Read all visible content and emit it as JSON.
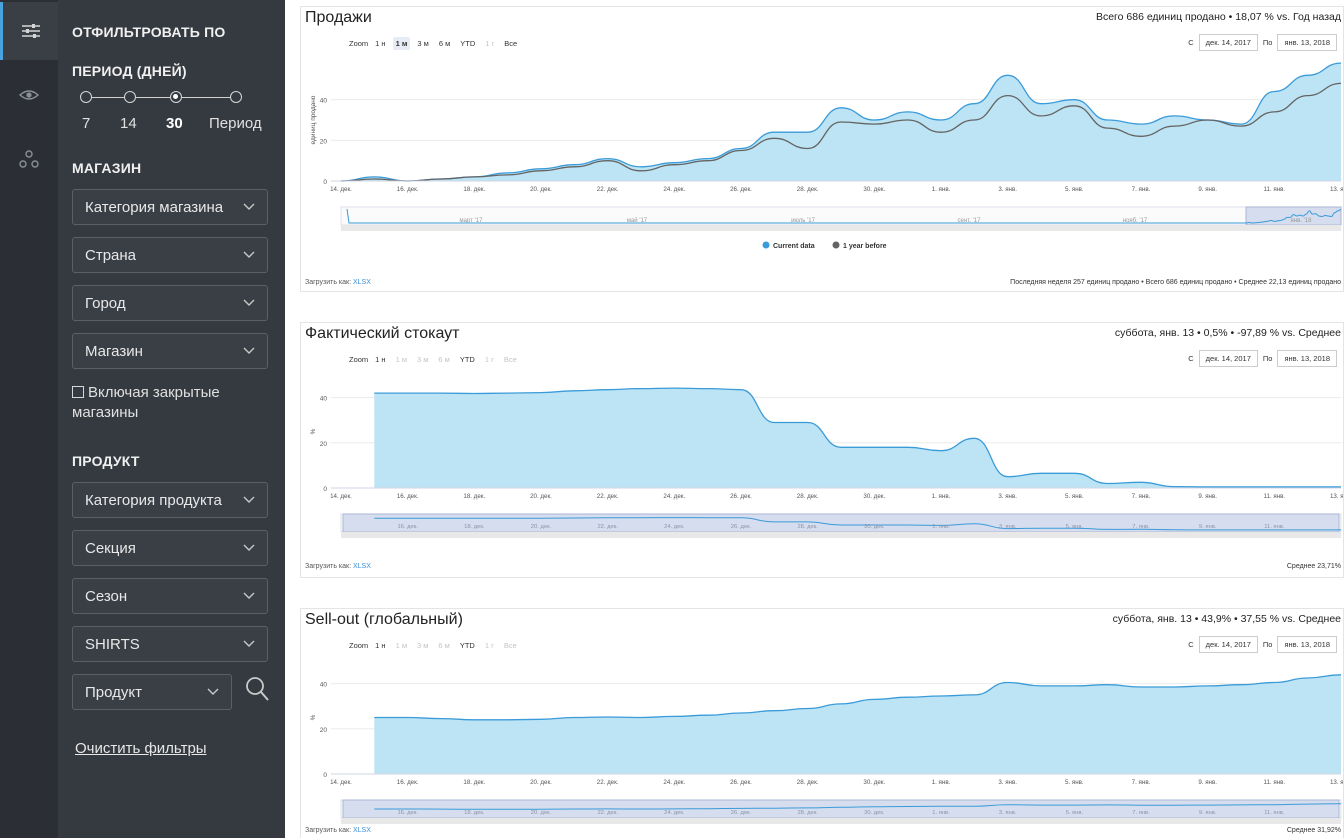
{
  "rail": {
    "icons": [
      "sliders-icon",
      "eye-icon",
      "nodes-icon"
    ]
  },
  "sidebar": {
    "filter_heading": "ОТФИЛЬТРОВАТЬ ПО",
    "period_heading": "ПЕРИОД (ДНЕЙ)",
    "period_options": [
      "7",
      "14",
      "30",
      "Период"
    ],
    "period_selected": "30",
    "store_heading": "МАГАЗИН",
    "store_category": "Категория магазина",
    "country": "Страна",
    "city": "Город",
    "store": "Магазин",
    "include_closed": "Включая закрытые магазины",
    "product_heading": "ПРОДУКТ",
    "product_category": "Категория продукта",
    "section": "Секция",
    "season": "Сезон",
    "shirts": "SHIRTS",
    "product": "Продукт",
    "clear_filters": "Очистить фильтры"
  },
  "zoom": {
    "label": "Zoom",
    "buttons": [
      "1 н",
      "1 м",
      "3 м",
      "6 м",
      "YTD",
      "1 г",
      "Все"
    ]
  },
  "range": {
    "from_label": "С",
    "from_value": "дек. 14, 2017",
    "to_label": "По",
    "to_value": "янв. 13, 2018"
  },
  "download": {
    "label": "Загрузить как:",
    "format": "XLSX"
  },
  "colors": {
    "current": "#3a9bd9",
    "fill": "#bde4f4",
    "prior": "#646464",
    "navigator": "#d6ddee"
  },
  "x_ticks": [
    "14. дек.",
    "16. дек.",
    "18. дек.",
    "20. дек.",
    "22. дек.",
    "24. дек.",
    "26. дек.",
    "28. дек.",
    "30. дек.",
    "1. янв.",
    "3. янв.",
    "5. янв.",
    "7. янв.",
    "9. янв.",
    "11. янв.",
    "13. янв."
  ],
  "sales": {
    "title": "Продажи",
    "summary": "Всего 686 единиц продано • 18,07 % vs. Год назад",
    "ylabel": "единиц продано",
    "yticks": [
      "0",
      "20",
      "40"
    ],
    "navigator_labels": [
      "март '17",
      "май '17",
      "июль '17",
      "сент. '17",
      "нояб. '17",
      "янв. '18"
    ],
    "legend_current": "Current data",
    "legend_prior": "1 year before",
    "footnote": "Последняя неделя 257 единиц продано • Всего 686 единиц продано • Среднее 22,13 единиц продано"
  },
  "stockout": {
    "title": "Фактический стокаут",
    "summary": "суббота, янв. 13 • 0,5% • -97,89 % vs. Среднее",
    "ylabel": "%",
    "yticks": [
      "0",
      "20",
      "40"
    ],
    "navigator_labels": [
      "16. дек.",
      "18. дек.",
      "20. дек.",
      "22. дек.",
      "24. дек.",
      "26. дек.",
      "28. дек.",
      "30. дек.",
      "1. янв.",
      "3. янв.",
      "5. янв.",
      "7. янв.",
      "9. янв.",
      "11. янв."
    ],
    "footnote": "Среднее 23,71%"
  },
  "sellout": {
    "title": "Sell-out (глобальный)",
    "summary": "суббота, янв. 13 • 43,9% • 37,55 % vs. Среднее",
    "ylabel": "%",
    "yticks": [
      "0",
      "20",
      "40"
    ],
    "navigator_labels": [
      "16. дек.",
      "18. дек.",
      "20. дек.",
      "22. дек.",
      "24. дек.",
      "26. дек.",
      "28. дек.",
      "30. дек.",
      "1. янв.",
      "3. янв.",
      "5. янв.",
      "7. янв.",
      "9. янв.",
      "11. янв."
    ],
    "footnote": "Среднее 31,92%"
  },
  "chart_data": [
    {
      "type": "area",
      "title": "Продажи",
      "xlabel": "",
      "ylabel": "единиц продано",
      "ylim": [
        0,
        60
      ],
      "x": [
        "14. дек.",
        "15. дек.",
        "16. дек.",
        "17. дек.",
        "18. дек.",
        "19. дек.",
        "20. дек.",
        "21. дек.",
        "22. дек.",
        "23. дек.",
        "24. дек.",
        "25. дек.",
        "26. дек.",
        "27. дек.",
        "28. дек.",
        "29. дек.",
        "30. дек.",
        "31. дек.",
        "1. янв.",
        "2. янв.",
        "3. янв.",
        "4. янв.",
        "5. янв.",
        "6. янв.",
        "7. янв.",
        "8. янв.",
        "9. янв.",
        "10. янв.",
        "11. янв.",
        "12. янв.",
        "13. янв."
      ],
      "series": [
        {
          "name": "Current data",
          "values": [
            0,
            2,
            0,
            1,
            2,
            4,
            6,
            8,
            11,
            7,
            9,
            11,
            16,
            24,
            24,
            36,
            30,
            34,
            30,
            38,
            52,
            38,
            40,
            30,
            28,
            32,
            30,
            28,
            44,
            52,
            58
          ]
        },
        {
          "name": "1 year before",
          "values": [
            0,
            1,
            0,
            1,
            2,
            3,
            5,
            7,
            10,
            5,
            8,
            10,
            15,
            21,
            16,
            29,
            28,
            30,
            24,
            30,
            42,
            32,
            37,
            26,
            22,
            27,
            30,
            27,
            34,
            42,
            48
          ]
        }
      ]
    },
    {
      "type": "area",
      "title": "Фактический стокаут",
      "xlabel": "",
      "ylabel": "%",
      "ylim": [
        0,
        50
      ],
      "x": [
        "14. дек.",
        "15. дек.",
        "16. дек.",
        "17. дек.",
        "18. дек.",
        "19. дек.",
        "20. дек.",
        "21. дек.",
        "22. дек.",
        "23. дек.",
        "24. дек.",
        "25. дек.",
        "26. дек.",
        "27. дек.",
        "28. дек.",
        "29. дек.",
        "30. дек.",
        "31. дек.",
        "1. янв.",
        "2. янв.",
        "3. янв.",
        "4. янв.",
        "5. янв.",
        "6. янв.",
        "7. янв.",
        "8. янв.",
        "9. янв.",
        "10. янв.",
        "11. янв.",
        "12. янв.",
        "13. янв."
      ],
      "series": [
        {
          "name": "",
          "values": [
            null,
            42,
            42,
            42,
            41.8,
            42,
            42.2,
            43,
            43.5,
            44,
            44.2,
            44,
            43.5,
            29,
            29,
            18,
            18,
            18,
            16.5,
            22,
            5,
            6.5,
            6.5,
            2,
            2.5,
            0.6,
            0.5,
            0.5,
            0.5,
            0.5,
            0.5
          ]
        }
      ]
    },
    {
      "type": "area",
      "title": "Sell-out (глобальный)",
      "xlabel": "",
      "ylabel": "%",
      "ylim": [
        0,
        50
      ],
      "x": [
        "14. дек.",
        "15. дек.",
        "16. дек.",
        "17. дек.",
        "18. дек.",
        "19. дек.",
        "20. дек.",
        "21. дек.",
        "22. дек.",
        "23. дек.",
        "24. дек.",
        "25. дек.",
        "26. дек.",
        "27. дек.",
        "28. дек.",
        "29. дек.",
        "30. дек.",
        "31. дек.",
        "1. янв.",
        "2. янв.",
        "3. янв.",
        "4. янв.",
        "5. янв.",
        "6. янв.",
        "7. янв.",
        "8. янв.",
        "9. янв.",
        "10. янв.",
        "11. янв.",
        "12. янв.",
        "13. янв."
      ],
      "series": [
        {
          "name": "",
          "values": [
            null,
            25,
            25,
            24.5,
            24,
            24,
            24.2,
            25,
            25.2,
            25,
            25.5,
            26,
            27,
            28,
            29,
            31,
            33,
            34,
            34.5,
            35,
            40.5,
            39,
            39,
            39.5,
            38.5,
            38.5,
            39,
            39.5,
            40.5,
            42.5,
            43.9
          ]
        }
      ]
    }
  ]
}
